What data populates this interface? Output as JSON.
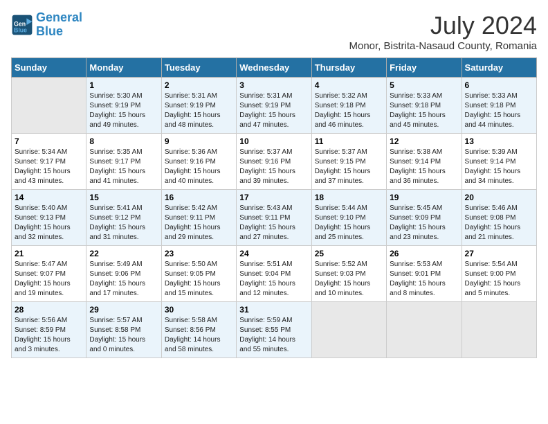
{
  "header": {
    "logo_line1": "General",
    "logo_line2": "Blue",
    "month": "July 2024",
    "location": "Monor, Bistrita-Nasaud County, Romania"
  },
  "weekdays": [
    "Sunday",
    "Monday",
    "Tuesday",
    "Wednesday",
    "Thursday",
    "Friday",
    "Saturday"
  ],
  "weeks": [
    [
      {
        "day": "",
        "info": ""
      },
      {
        "day": "1",
        "info": "Sunrise: 5:30 AM\nSunset: 9:19 PM\nDaylight: 15 hours\nand 49 minutes."
      },
      {
        "day": "2",
        "info": "Sunrise: 5:31 AM\nSunset: 9:19 PM\nDaylight: 15 hours\nand 48 minutes."
      },
      {
        "day": "3",
        "info": "Sunrise: 5:31 AM\nSunset: 9:19 PM\nDaylight: 15 hours\nand 47 minutes."
      },
      {
        "day": "4",
        "info": "Sunrise: 5:32 AM\nSunset: 9:18 PM\nDaylight: 15 hours\nand 46 minutes."
      },
      {
        "day": "5",
        "info": "Sunrise: 5:33 AM\nSunset: 9:18 PM\nDaylight: 15 hours\nand 45 minutes."
      },
      {
        "day": "6",
        "info": "Sunrise: 5:33 AM\nSunset: 9:18 PM\nDaylight: 15 hours\nand 44 minutes."
      }
    ],
    [
      {
        "day": "7",
        "info": "Sunrise: 5:34 AM\nSunset: 9:17 PM\nDaylight: 15 hours\nand 43 minutes."
      },
      {
        "day": "8",
        "info": "Sunrise: 5:35 AM\nSunset: 9:17 PM\nDaylight: 15 hours\nand 41 minutes."
      },
      {
        "day": "9",
        "info": "Sunrise: 5:36 AM\nSunset: 9:16 PM\nDaylight: 15 hours\nand 40 minutes."
      },
      {
        "day": "10",
        "info": "Sunrise: 5:37 AM\nSunset: 9:16 PM\nDaylight: 15 hours\nand 39 minutes."
      },
      {
        "day": "11",
        "info": "Sunrise: 5:37 AM\nSunset: 9:15 PM\nDaylight: 15 hours\nand 37 minutes."
      },
      {
        "day": "12",
        "info": "Sunrise: 5:38 AM\nSunset: 9:14 PM\nDaylight: 15 hours\nand 36 minutes."
      },
      {
        "day": "13",
        "info": "Sunrise: 5:39 AM\nSunset: 9:14 PM\nDaylight: 15 hours\nand 34 minutes."
      }
    ],
    [
      {
        "day": "14",
        "info": "Sunrise: 5:40 AM\nSunset: 9:13 PM\nDaylight: 15 hours\nand 32 minutes."
      },
      {
        "day": "15",
        "info": "Sunrise: 5:41 AM\nSunset: 9:12 PM\nDaylight: 15 hours\nand 31 minutes."
      },
      {
        "day": "16",
        "info": "Sunrise: 5:42 AM\nSunset: 9:11 PM\nDaylight: 15 hours\nand 29 minutes."
      },
      {
        "day": "17",
        "info": "Sunrise: 5:43 AM\nSunset: 9:11 PM\nDaylight: 15 hours\nand 27 minutes."
      },
      {
        "day": "18",
        "info": "Sunrise: 5:44 AM\nSunset: 9:10 PM\nDaylight: 15 hours\nand 25 minutes."
      },
      {
        "day": "19",
        "info": "Sunrise: 5:45 AM\nSunset: 9:09 PM\nDaylight: 15 hours\nand 23 minutes."
      },
      {
        "day": "20",
        "info": "Sunrise: 5:46 AM\nSunset: 9:08 PM\nDaylight: 15 hours\nand 21 minutes."
      }
    ],
    [
      {
        "day": "21",
        "info": "Sunrise: 5:47 AM\nSunset: 9:07 PM\nDaylight: 15 hours\nand 19 minutes."
      },
      {
        "day": "22",
        "info": "Sunrise: 5:49 AM\nSunset: 9:06 PM\nDaylight: 15 hours\nand 17 minutes."
      },
      {
        "day": "23",
        "info": "Sunrise: 5:50 AM\nSunset: 9:05 PM\nDaylight: 15 hours\nand 15 minutes."
      },
      {
        "day": "24",
        "info": "Sunrise: 5:51 AM\nSunset: 9:04 PM\nDaylight: 15 hours\nand 12 minutes."
      },
      {
        "day": "25",
        "info": "Sunrise: 5:52 AM\nSunset: 9:03 PM\nDaylight: 15 hours\nand 10 minutes."
      },
      {
        "day": "26",
        "info": "Sunrise: 5:53 AM\nSunset: 9:01 PM\nDaylight: 15 hours\nand 8 minutes."
      },
      {
        "day": "27",
        "info": "Sunrise: 5:54 AM\nSunset: 9:00 PM\nDaylight: 15 hours\nand 5 minutes."
      }
    ],
    [
      {
        "day": "28",
        "info": "Sunrise: 5:56 AM\nSunset: 8:59 PM\nDaylight: 15 hours\nand 3 minutes."
      },
      {
        "day": "29",
        "info": "Sunrise: 5:57 AM\nSunset: 8:58 PM\nDaylight: 15 hours\nand 0 minutes."
      },
      {
        "day": "30",
        "info": "Sunrise: 5:58 AM\nSunset: 8:56 PM\nDaylight: 14 hours\nand 58 minutes."
      },
      {
        "day": "31",
        "info": "Sunrise: 5:59 AM\nSunset: 8:55 PM\nDaylight: 14 hours\nand 55 minutes."
      },
      {
        "day": "",
        "info": ""
      },
      {
        "day": "",
        "info": ""
      },
      {
        "day": "",
        "info": ""
      }
    ]
  ]
}
